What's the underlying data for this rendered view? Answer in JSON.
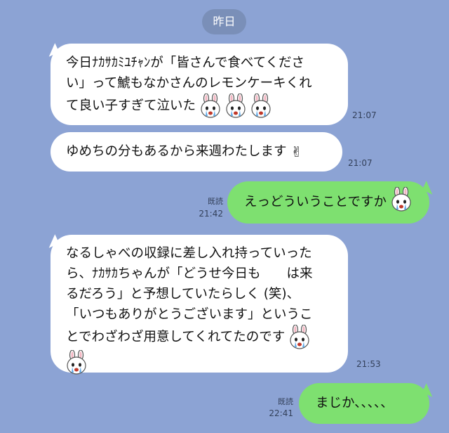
{
  "date_divider": "昨日",
  "messages": [
    {
      "side": "left",
      "lines": [
        "今日ﾅｶｻｶﾐﾕﾁｬﾝが「皆さんで食べてくださ",
        "い」って鯱もなかさんのレモンケーキくれ",
        "て良い子すぎて泣いた"
      ],
      "time": "21:07",
      "stickers": [
        "crying-bunny-icon",
        "crying-bunny-icon",
        "crying-bunny-icon"
      ]
    },
    {
      "side": "left",
      "lines": [
        "ゆめちの分もあるから来週わたします"
      ],
      "time": "21:07",
      "stickers": [
        "victory-hand-icon"
      ]
    },
    {
      "side": "right",
      "lines": [
        "えっどういうことですか"
      ],
      "read": "既読",
      "time": "21:42",
      "stickers": [
        "question-bunny-icon"
      ]
    },
    {
      "side": "left",
      "lines": [
        "なるしゃべの収録に差し入れ持っていった",
        "ら、ﾅｶｻｶちゃんが「どうせ今日も　　は来",
        "るだろう」と予想していたらしく (笑)、",
        "「いつもありがとうございます」というこ",
        "とでわざわざ用意してくれてたのです"
      ],
      "time": "21:53",
      "stickers": [
        "crying-bunny-icon",
        "crying-bunny-icon"
      ]
    },
    {
      "side": "right",
      "lines": [
        "まじか、、、、、"
      ],
      "read": "既読",
      "time": "22:41",
      "stickers": []
    }
  ],
  "colors": {
    "background": "#8ca3d4",
    "left_bubble": "#ffffff",
    "right_bubble": "#7ee070",
    "date_pill": "#7a8fb8"
  }
}
